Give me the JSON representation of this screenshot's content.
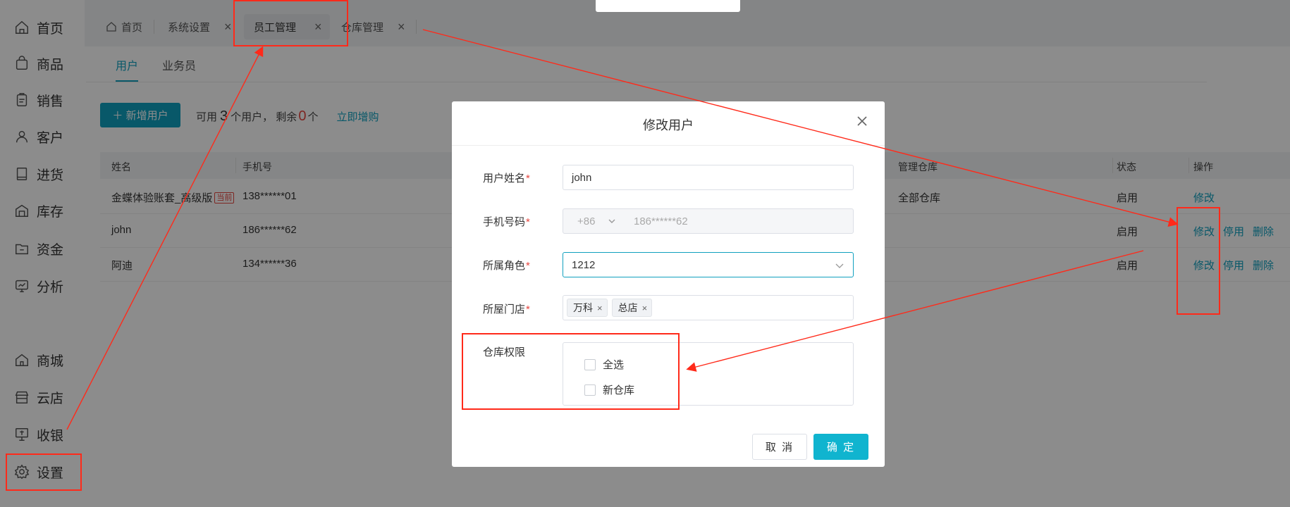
{
  "sidebar": {
    "items": [
      {
        "label": "首页",
        "icon": "home-icon"
      },
      {
        "label": "商品",
        "icon": "bag-icon"
      },
      {
        "label": "销售",
        "icon": "clipboard-icon"
      },
      {
        "label": "客户",
        "icon": "user-icon"
      },
      {
        "label": "进货",
        "icon": "book-icon"
      },
      {
        "label": "库存",
        "icon": "warehouse-icon"
      },
      {
        "label": "资金",
        "icon": "folder-icon"
      },
      {
        "label": "分析",
        "icon": "monitor-icon"
      },
      {
        "label": "商城",
        "icon": "store-icon"
      },
      {
        "label": "云店",
        "icon": "shop-icon"
      },
      {
        "label": "收银",
        "icon": "cashier-icon"
      },
      {
        "label": "设置",
        "icon": "gear-icon"
      }
    ]
  },
  "tabs": [
    {
      "label": "首页"
    },
    {
      "label": "系统设置"
    },
    {
      "label": "员工管理"
    },
    {
      "label": "仓库管理"
    }
  ],
  "subtabs": [
    {
      "label": "用户"
    },
    {
      "label": "业务员"
    }
  ],
  "toolbar": {
    "add_label": "＋ 新增用户",
    "quota_prefix": "可用",
    "quota_total": "3",
    "quota_mid": "个用户，  剩余",
    "quota_remain": "0",
    "quota_suffix": "个",
    "upgrade_link": "立即增购"
  },
  "table": {
    "headers": [
      "姓名",
      "手机号",
      "管理仓库",
      "状态",
      "操作"
    ],
    "rows": [
      {
        "name": "金蝶体验账套_高级版",
        "badge": "当前",
        "phone": "138******01",
        "warehouse": "全部仓库",
        "status": "启用",
        "ops": [
          "修改"
        ]
      },
      {
        "name": "john",
        "badge": "",
        "phone": "186******62",
        "warehouse": "",
        "status": "启用",
        "ops": [
          "修改",
          "停用",
          "删除"
        ]
      },
      {
        "name": "阿迪",
        "badge": "",
        "phone": "134******36",
        "warehouse": "",
        "status": "启用",
        "ops": [
          "修改",
          "停用",
          "删除"
        ]
      }
    ]
  },
  "modal": {
    "title": "修改用户",
    "fields": {
      "username": {
        "label": "用户姓名",
        "value": "john"
      },
      "phone": {
        "label": "手机号码",
        "country_code": "+86",
        "value": "186******62"
      },
      "role": {
        "label": "所属角色",
        "value": "1212"
      },
      "store": {
        "label": "所屋门店",
        "tags": [
          "万科",
          "总店"
        ]
      },
      "warehouse": {
        "label": "仓库权限",
        "options": [
          "全选",
          "新仓库"
        ]
      }
    },
    "cancel_label": "取 消",
    "ok_label": "确 定"
  },
  "colors": {
    "accent": "#10a0bf",
    "danger": "#e5463f",
    "annotation": "#ff2a1a"
  }
}
